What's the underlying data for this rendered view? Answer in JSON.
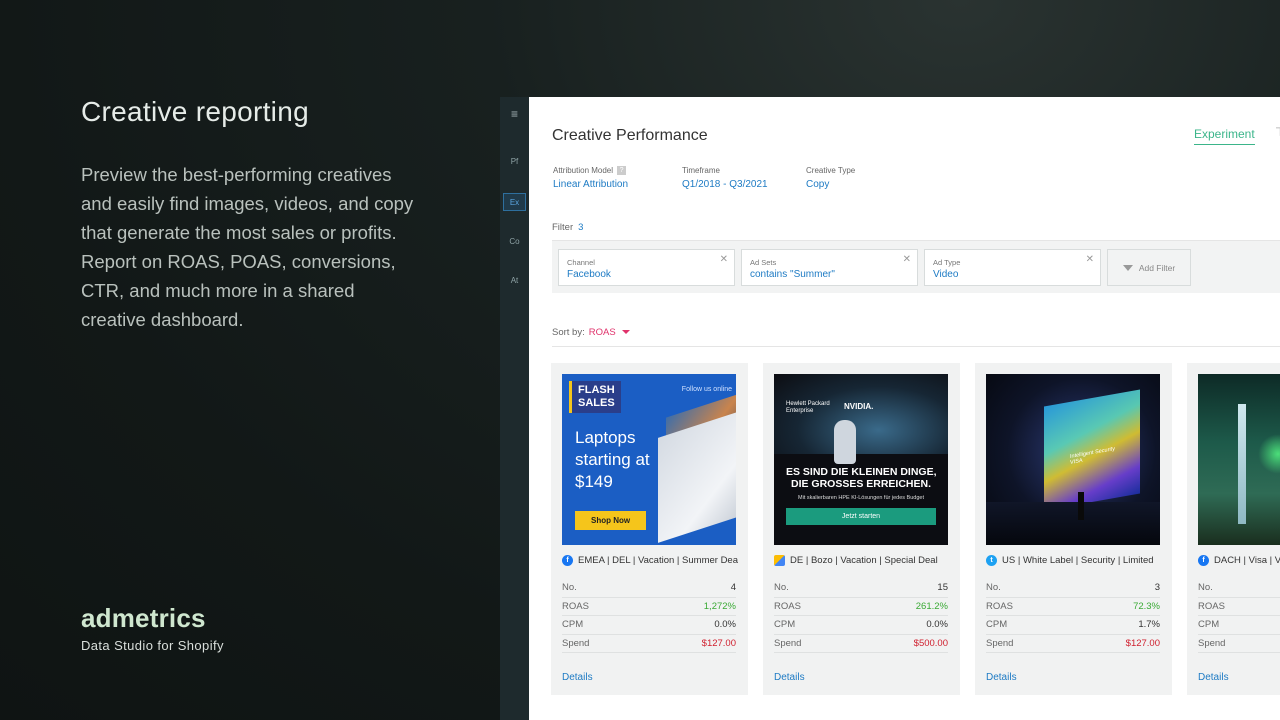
{
  "hero": {
    "title": "Creative reporting",
    "text": "Preview the best-performing creatives and easily find images, videos, and copy that generate the most sales or profits. Report on ROAS, POAS, conversions, CTR, and much more in a shared creative dashboard."
  },
  "brand": {
    "logo": "admetrics",
    "tagline": "Data Studio for Shopify"
  },
  "rail": {
    "menu": "≡",
    "items": [
      "Pf",
      "Ex",
      "Co",
      "At"
    ],
    "active": "Ex"
  },
  "app": {
    "title": "Creative Performance",
    "tab_experiment": "Experiment",
    "attribution": {
      "label": "Attribution Model",
      "help": "?",
      "value": "Linear Attribution"
    },
    "timeframe": {
      "label": "Timeframe",
      "value": "Q1/2018 - Q3/2021"
    },
    "creative_type": {
      "label": "Creative Type",
      "value": "Copy"
    },
    "filter": {
      "label": "Filter",
      "count": "3"
    },
    "chips": [
      {
        "label": "Channel",
        "value": "Facebook"
      },
      {
        "label": "Ad Sets",
        "value": "contains \"Summer\""
      },
      {
        "label": "Ad Type",
        "value": "Video"
      }
    ],
    "add_filter": "Add Filter",
    "sort": {
      "label": "Sort by:",
      "value": "ROAS"
    },
    "stat_labels": {
      "no": "No.",
      "roas": "ROAS",
      "cpm": "CPM",
      "spend": "Spend"
    },
    "details_label": "Details",
    "cards": [
      {
        "channel": "facebook",
        "title": "EMEA | DEL | Vacation | Summer Deal",
        "no": "4",
        "roas": "1,272%",
        "cpm": "0.0%",
        "spend": "$127.00"
      },
      {
        "channel": "google-ads",
        "title": "DE | Bozo | Vacation | Special Deal",
        "no": "15",
        "roas": "261.2%",
        "cpm": "0.0%",
        "spend": "$500.00"
      },
      {
        "channel": "twitter",
        "title": "US | White Label | Security | Limited",
        "no": "3",
        "roas": "72.3%",
        "cpm": "1.7%",
        "spend": "$127.00"
      },
      {
        "channel": "facebook",
        "title": "DACH | Visa | Vacation",
        "no": "",
        "roas": "",
        "cpm": "",
        "spend": ""
      }
    ]
  },
  "ads": {
    "ad1": {
      "badge": "FLASH\nSALES",
      "follow": "Follow us online",
      "text": "Laptops\nstarting at\n$149",
      "button": "Shop Now"
    },
    "ad2": {
      "logo1": "Hewlett Packard\nEnterprise",
      "logo2": "NVIDIA.",
      "headline": "ES SIND DIE KLEINEN DINGE,\nDIE GROSSES ERREICHEN.",
      "sub": "Mit skalierbaren HPE KI-Lösungen für jedes Budget",
      "button": "Jetzt starten"
    },
    "ad3": {
      "label": "Intelligent Security\nVISA"
    }
  },
  "colors": {
    "accent_blue": "#1e7bc4",
    "positive": "#3aaa35",
    "negative": "#d0202f",
    "sort": "#e0326b",
    "experiment": "#3bb58a"
  }
}
